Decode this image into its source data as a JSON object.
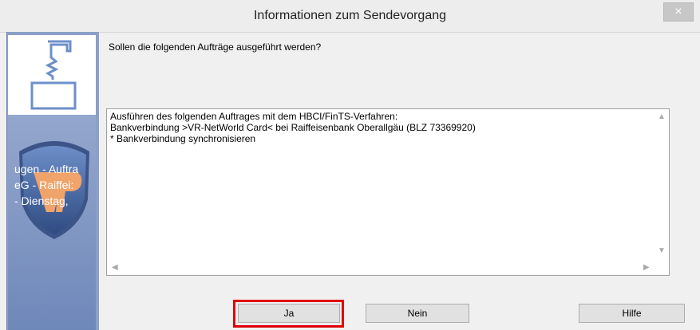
{
  "window": {
    "title": "Informationen zum Sendevorgang",
    "close_glyph": "×"
  },
  "sidebar": {
    "shield_lines": [
      "ugen - Auftra",
      "eG - Raiffei:",
      "- Dienstag,"
    ]
  },
  "main": {
    "question": "Sollen die folgenden Aufträge ausgeführt werden?",
    "details": [
      "Ausführen des folgenden Auftrages mit dem HBCI/FinTS-Verfahren:",
      "Bankverbindung >VR-NetWorld Card< bei Raiffeisenbank Oberallgäu (BLZ 73369920)",
      "* Bankverbindung synchronisieren"
    ]
  },
  "buttons": {
    "ja": "Ja",
    "nein": "Nein",
    "hilfe": "Hilfe"
  },
  "colors": {
    "highlight": "#e00000",
    "sidebar": "#8aa0c8"
  },
  "icons": {
    "close": "close-icon",
    "transfer": "transfer-icon",
    "shield": "vr-shield-icon",
    "scroll_up": "scroll-up-icon",
    "scroll_down": "scroll-down-icon",
    "scroll_left": "scroll-left-icon",
    "scroll_right": "scroll-right-icon"
  }
}
